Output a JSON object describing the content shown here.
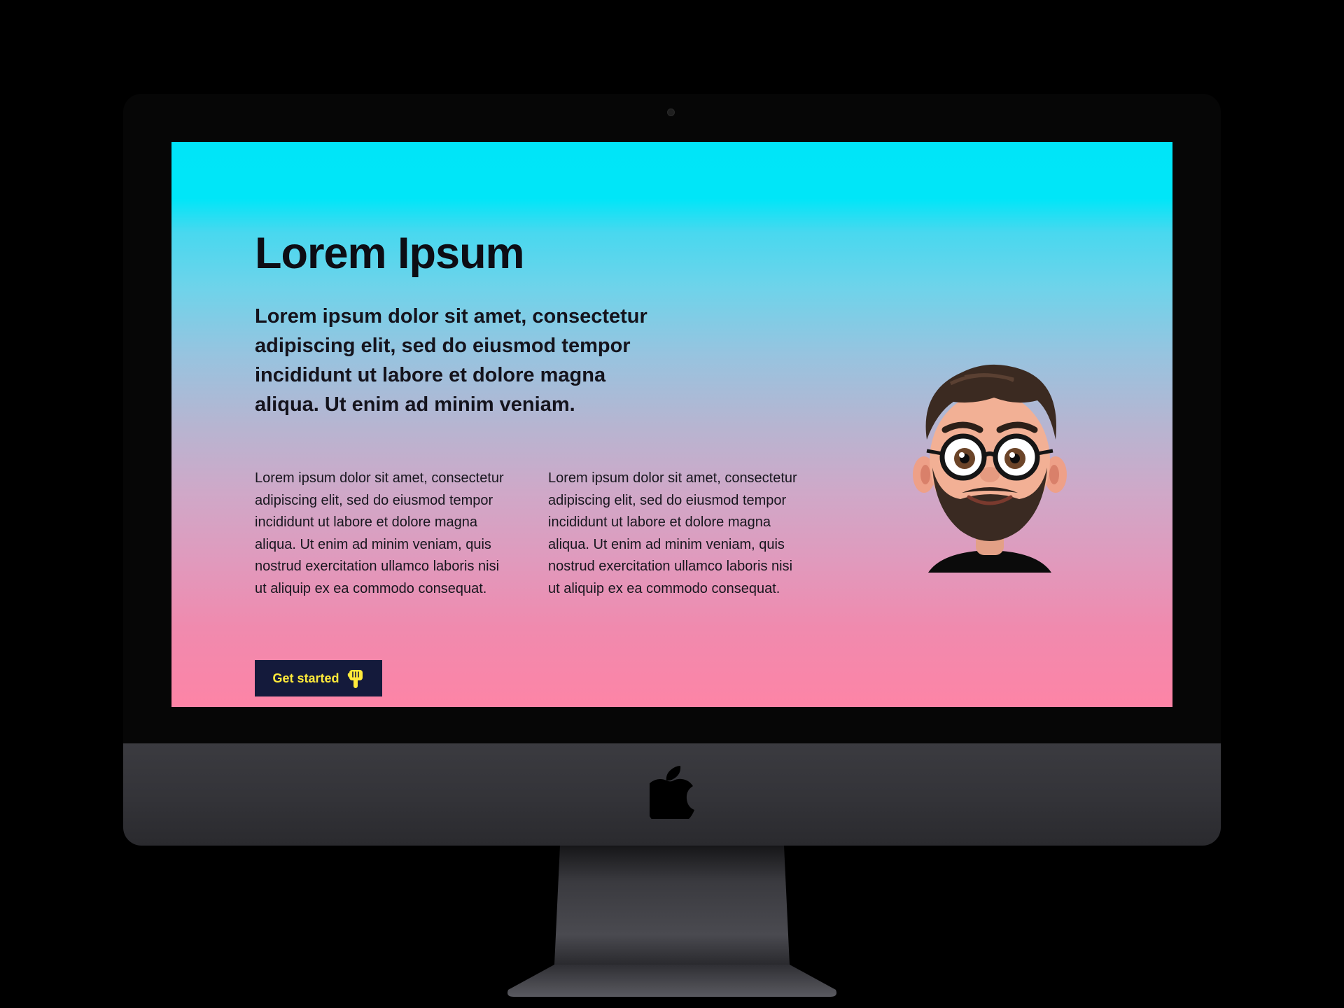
{
  "hero": {
    "title": "Lorem Ipsum",
    "lead": "Lorem ipsum dolor sit amet, consectetur adipiscing elit, sed do eiusmod tempor incididunt ut labore et dolore magna aliqua. Ut enim ad minim veniam.",
    "columns": [
      "Lorem ipsum dolor sit amet, consectetur adipiscing elit, sed do eiusmod tempor incididunt ut labore et dolore magna aliqua. Ut enim ad minim veniam, quis nostrud exercitation ullamco laboris nisi ut aliquip ex ea commodo consequat.",
      "Lorem ipsum dolor sit amet, consectetur adipiscing elit, sed do eiusmod tempor incididunt ut labore et dolore magna aliqua. Ut enim ad minim veniam, quis nostrud exercitation ullamco laboris nisi ut aliquip ex ea commodo consequat."
    ],
    "cta_label": "Get started",
    "cta_icon": "hand-pointing-down-icon",
    "avatar_icon": "cartoon-avatar-icon"
  },
  "device": {
    "brand_icon": "apple-logo-icon",
    "camera_icon": "webcam-icon"
  },
  "colors": {
    "gradient_top": "#00e5f8",
    "gradient_bottom": "#fd84a6",
    "cta_background": "#141a3b",
    "cta_text": "#ffea3a",
    "text": "#14131c"
  }
}
